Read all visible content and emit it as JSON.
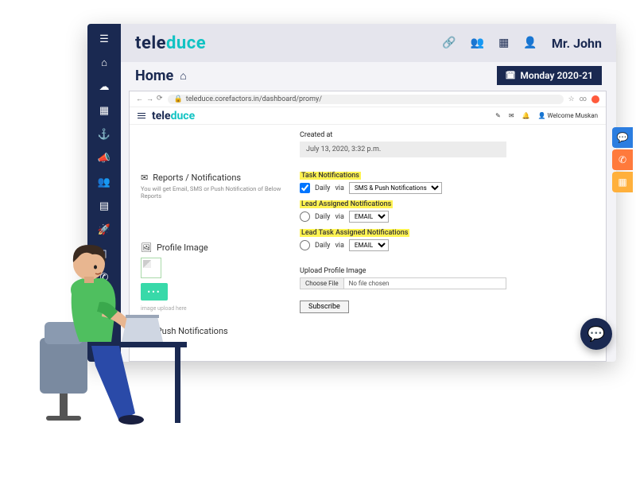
{
  "outer": {
    "brand_left": "tele",
    "brand_right": "duce",
    "user": "Mr. John",
    "page_title": "Home",
    "date_badge": "Monday 2020-21"
  },
  "browser": {
    "url": "teleduce.corefactors.in/dashboard/promy/",
    "welcome": "Welcome Muskan"
  },
  "form": {
    "created_at_label": "Created at",
    "created_at_value": "July 13, 2020, 3:32 p.m.",
    "reports_heading": "Reports / Notifications",
    "reports_sub": "You will get Email, SMS or Push Notification of Below Reports",
    "groups": [
      {
        "title": "Task Notifications",
        "checked": true,
        "type": "checkbox",
        "freq": "Daily",
        "via": "via",
        "method": "SMS & Push Notifications"
      },
      {
        "title": "Lead Assigned Notifications",
        "checked": false,
        "type": "radio",
        "freq": "Daily",
        "via": "via",
        "method": "EMAIL"
      },
      {
        "title": "Lead Task Assigned Notifications",
        "checked": false,
        "type": "radio",
        "freq": "Daily",
        "via": "via",
        "method": "EMAIL"
      }
    ],
    "profile_heading": "Profile Image",
    "profile_note": "image upload here",
    "upload_label": "Upload Profile Image",
    "choose_file": "Choose File",
    "no_file": "No file chosen",
    "push_heading": "Push Notifications",
    "subscribe": "Subscribe"
  }
}
